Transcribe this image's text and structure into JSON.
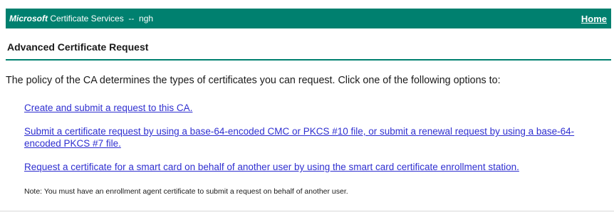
{
  "banner": {
    "brand": "Microsoft",
    "product": " Certificate Services",
    "separator": "  --  ",
    "ca_name": "ngh",
    "home_link": "Home"
  },
  "page": {
    "title": "Advanced Certificate Request",
    "intro": "The policy of the CA determines the types of certificates you can request. Click one of the following options to:"
  },
  "options": [
    {
      "label": "Create and submit a request to this CA."
    },
    {
      "label": "Submit a certificate request by using a base-64-encoded CMC or PKCS #10 file, or submit a renewal request by using a base-64-encoded PKCS #7 file."
    },
    {
      "label": "Request a certificate for a smart card on behalf of another user by using the smart card certificate enrollment station."
    }
  ],
  "note": "Note: You must have an enrollment agent certificate to submit a request on behalf of another user.",
  "colors": {
    "banner": "#00806f",
    "link": "#2f2fd0"
  }
}
